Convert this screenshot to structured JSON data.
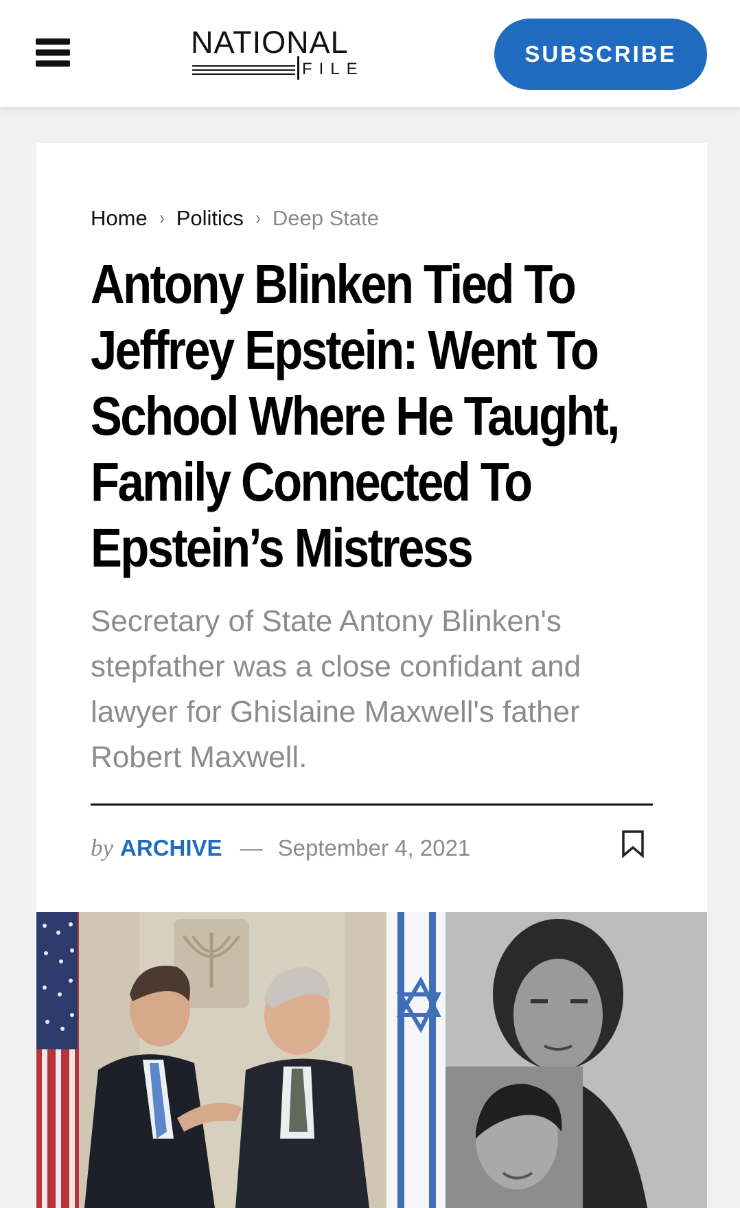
{
  "header": {
    "logo_top": "NATIONAL",
    "logo_bottom": "FILE",
    "subscribe_label": "SUBSCRIBE",
    "menu_icon": "hamburger-menu-icon"
  },
  "breadcrumb": {
    "items": [
      "Home",
      "Politics",
      "Deep State"
    ],
    "separator": "›"
  },
  "article": {
    "title_lines": [
      "Antony Blinken Tied To",
      "Jeffrey Epstein: Went To",
      "School Where He Taught,",
      "Family Connected To",
      "Epstein’s Mistress"
    ],
    "excerpt_lines": [
      "Secretary of State Antony Blinken's",
      "stepfather was a close confidant and",
      "lawyer for Ghislaine Maxwell's father",
      "Robert Maxwell."
    ],
    "by_label": "by",
    "author": "ARCHIVE",
    "dash": "—",
    "date": "September 4, 2021",
    "bookmark_icon": "bookmark-icon"
  },
  "colors": {
    "accent": "#1e6bbf",
    "page_bg": "#f1f1f1",
    "muted_text": "#8c8c8c"
  }
}
